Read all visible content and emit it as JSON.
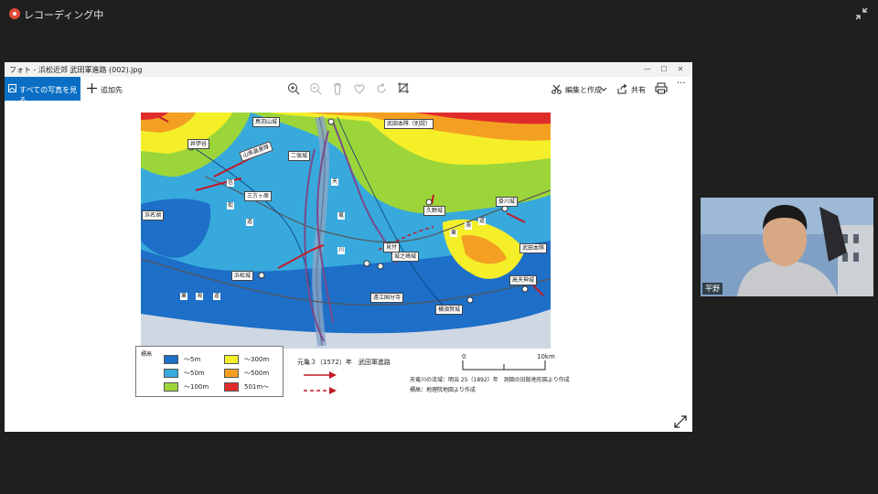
{
  "recording": {
    "label": "レコーディング中"
  },
  "window": {
    "title": "フォト - 浜松近郊 武田軍進路 (002).jpg",
    "controls": {
      "minimize": "—",
      "maximize": "☐",
      "close": "✕"
    }
  },
  "toolbar": {
    "all_photos": "すべての写真を見る",
    "add_to": "追加先",
    "edit_create": "編集と作成",
    "share": "共有",
    "more": "···"
  },
  "map": {
    "place_labels": [
      "鳥羽山城",
      "武田本隊（別説）",
      "井伊谷",
      "山県昌景隊",
      "二俣城",
      "三方ヶ原",
      "久野城",
      "掛川城",
      "浜名湖",
      "見付",
      "城之崎城",
      "武田本隊",
      "浜松城",
      "高天神城",
      "遠江国分寺",
      "横須賀城"
    ],
    "road_chars": [
      "信",
      "街",
      "道",
      "東",
      "海",
      "道",
      "天",
      "竜",
      "川",
      "東",
      "海",
      "道"
    ],
    "scale_zero": "0",
    "scale_10km": "10km"
  },
  "legend": {
    "title": "標高",
    "items": [
      {
        "label": "〜5m",
        "color": "#1d6fc7"
      },
      {
        "label": "〜50m",
        "color": "#37a9dd"
      },
      {
        "label": "〜100m",
        "color": "#9cd53a"
      },
      {
        "label": "〜300m",
        "color": "#f5ef2a"
      },
      {
        "label": "〜500m",
        "color": "#f3a022"
      },
      {
        "label": "501m〜",
        "color": "#e02b2b"
      }
    ]
  },
  "caption": {
    "era": "元亀３（1572）年　武田軍進路",
    "source1": "天竜川の流域：明治 25（1892）年　測図の旧版地形図より作成",
    "source2": "標高：地理院地図より作成"
  },
  "webcam": {
    "name": "平野"
  }
}
